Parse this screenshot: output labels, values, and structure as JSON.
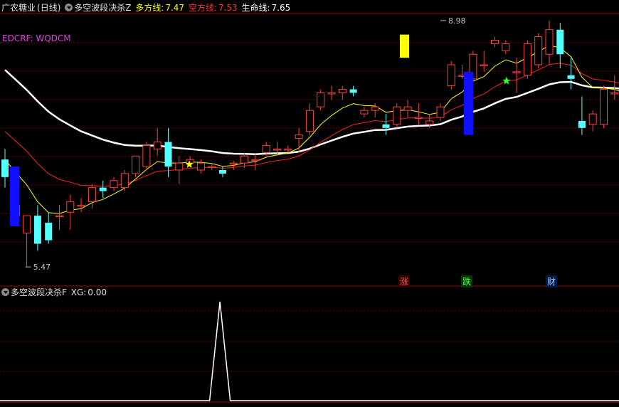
{
  "header": {
    "stock_name": "广农糖业",
    "period": "(日线)",
    "indicator_name": "多空波段决杀Z",
    "bull_label": "多方线:",
    "bull_value": "7.47",
    "bear_label": "空方线:",
    "bear_value": "7.53",
    "life_label": "生命线:",
    "life_value": "7.65"
  },
  "legend_line": "EDCRF: WQDCM",
  "sub_header": {
    "indicator_name": "多空波段决杀F",
    "xg_label": "XG:",
    "xg_value": "0.00"
  },
  "tags": {
    "zhang": "涨",
    "die": "跌",
    "cai": "财"
  },
  "colors": {
    "up": "#ff4040",
    "down": "#54ffff",
    "bull_line": "#ffff00",
    "bear_line": "#ff2020",
    "life_line": "#ffffff",
    "grid": "#800000",
    "blue_bar": "#1010ff",
    "yellow_bar": "#ffff00"
  },
  "chart_data": [
    {
      "type": "candlestick",
      "series": [
        {
          "name": "K",
          "ohlc": [
            [
              7.0,
              7.15,
              6.6,
              6.75
            ],
            [
              6.2,
              6.45,
              6.05,
              6.35
            ],
            [
              5.95,
              6.2,
              5.47,
              6.2
            ],
            [
              6.2,
              6.35,
              5.7,
              5.8
            ],
            [
              6.1,
              6.25,
              5.8,
              5.85
            ],
            [
              6.2,
              6.35,
              6.0,
              6.2
            ],
            [
              6.25,
              6.5,
              6.0,
              6.4
            ],
            [
              6.35,
              6.45,
              6.25,
              6.35
            ],
            [
              6.4,
              6.65,
              6.3,
              6.6
            ],
            [
              6.6,
              6.7,
              6.45,
              6.55
            ],
            [
              6.6,
              6.75,
              6.55,
              6.7
            ],
            [
              6.6,
              6.85,
              6.55,
              6.8
            ],
            [
              6.8,
              7.05,
              6.75,
              7.05
            ],
            [
              6.9,
              7.25,
              6.85,
              7.2
            ],
            [
              7.15,
              7.45,
              7.05,
              7.25
            ],
            [
              7.25,
              7.45,
              6.75,
              6.9
            ],
            [
              6.85,
              7.05,
              6.65,
              6.95
            ],
            [
              6.95,
              7.05,
              6.9,
              7.0
            ],
            [
              6.85,
              7.0,
              6.8,
              6.95
            ],
            [
              6.9,
              6.95,
              6.85,
              6.9
            ],
            [
              6.85,
              6.9,
              6.75,
              6.8
            ],
            [
              6.95,
              6.98,
              6.85,
              6.95
            ],
            [
              6.95,
              7.1,
              6.88,
              7.05
            ],
            [
              7.0,
              7.08,
              6.85,
              7.0
            ],
            [
              7.1,
              7.25,
              7.05,
              7.2
            ],
            [
              7.15,
              7.25,
              7.05,
              7.15
            ],
            [
              7.15,
              7.2,
              7.1,
              7.15
            ],
            [
              7.3,
              7.45,
              7.1,
              7.35
            ],
            [
              7.4,
              7.8,
              7.35,
              7.7
            ],
            [
              7.75,
              8.0,
              7.7,
              7.95
            ],
            [
              7.95,
              8.05,
              7.85,
              7.95
            ],
            [
              7.95,
              8.05,
              7.85,
              8.0
            ],
            [
              8.0,
              8.05,
              7.9,
              7.95
            ],
            [
              7.65,
              7.75,
              7.6,
              7.7
            ],
            [
              7.7,
              7.8,
              7.6,
              7.75
            ],
            [
              7.5,
              7.65,
              7.35,
              7.45
            ],
            [
              7.5,
              7.8,
              7.45,
              7.75
            ],
            [
              7.7,
              7.85,
              7.6,
              7.75
            ],
            [
              7.6,
              7.8,
              7.5,
              7.6
            ],
            [
              7.5,
              7.65,
              7.45,
              7.55
            ],
            [
              7.6,
              7.8,
              7.55,
              7.75
            ],
            [
              8.05,
              8.4,
              8.0,
              8.35
            ],
            [
              8.2,
              8.35,
              8.15,
              8.2
            ],
            [
              8.15,
              8.55,
              8.1,
              8.5
            ],
            [
              8.35,
              8.55,
              8.25,
              8.35
            ],
            [
              8.65,
              8.75,
              8.6,
              8.7
            ],
            [
              8.55,
              8.7,
              8.5,
              8.65
            ],
            [
              8.25,
              8.45,
              7.95,
              8.25
            ],
            [
              8.2,
              8.7,
              8.15,
              8.65
            ],
            [
              8.35,
              8.8,
              8.3,
              8.75
            ],
            [
              8.5,
              8.98,
              8.35,
              8.85
            ],
            [
              8.85,
              8.95,
              8.3,
              8.5
            ],
            [
              8.2,
              8.45,
              8.0,
              8.15
            ],
            [
              7.55,
              7.9,
              7.35,
              7.45
            ],
            [
              7.5,
              7.7,
              7.4,
              7.65
            ],
            [
              7.5,
              8.05,
              7.45,
              8.0
            ],
            [
              7.95,
              8.2,
              7.85,
              7.95
            ],
            [
              7.85,
              7.9,
              7.7,
              7.8
            ],
            [
              7.85,
              7.9,
              7.75,
              7.8
            ],
            [
              7.8,
              7.85,
              7.7,
              7.75
            ],
            [
              7.6,
              7.65,
              7.4,
              7.45
            ],
            [
              7.45,
              7.7,
              7.4,
              7.65
            ],
            [
              7.6,
              7.75,
              7.55,
              7.7
            ],
            [
              7.95,
              8.4,
              7.9,
              8.3
            ],
            [
              8.3,
              8.35,
              8.2,
              8.3
            ],
            [
              8.3,
              8.48,
              8.3,
              8.3
            ],
            [
              8.25,
              8.38,
              8.18,
              8.35
            ],
            [
              8.2,
              8.32,
              8.15,
              8.25
            ]
          ]
        }
      ],
      "markers": {
        "high_label": "8.98",
        "low_label": "5.47"
      }
    },
    {
      "type": "line",
      "series": [
        {
          "name": "XG",
          "values": [
            0,
            0,
            0,
            0,
            0,
            0,
            0,
            0,
            0,
            0,
            0,
            0,
            0,
            0,
            0,
            0,
            0,
            1,
            0,
            0,
            0,
            0,
            0,
            0,
            0,
            0,
            0,
            0,
            0,
            0,
            0,
            0,
            0,
            0,
            0,
            0,
            0,
            0,
            0,
            0,
            0,
            0,
            0,
            0,
            0,
            0,
            0,
            0,
            0,
            0,
            0,
            0,
            0,
            0,
            0,
            0,
            0,
            0,
            0,
            0,
            0,
            0,
            0,
            0,
            0,
            0,
            0,
            0
          ]
        }
      ]
    }
  ]
}
